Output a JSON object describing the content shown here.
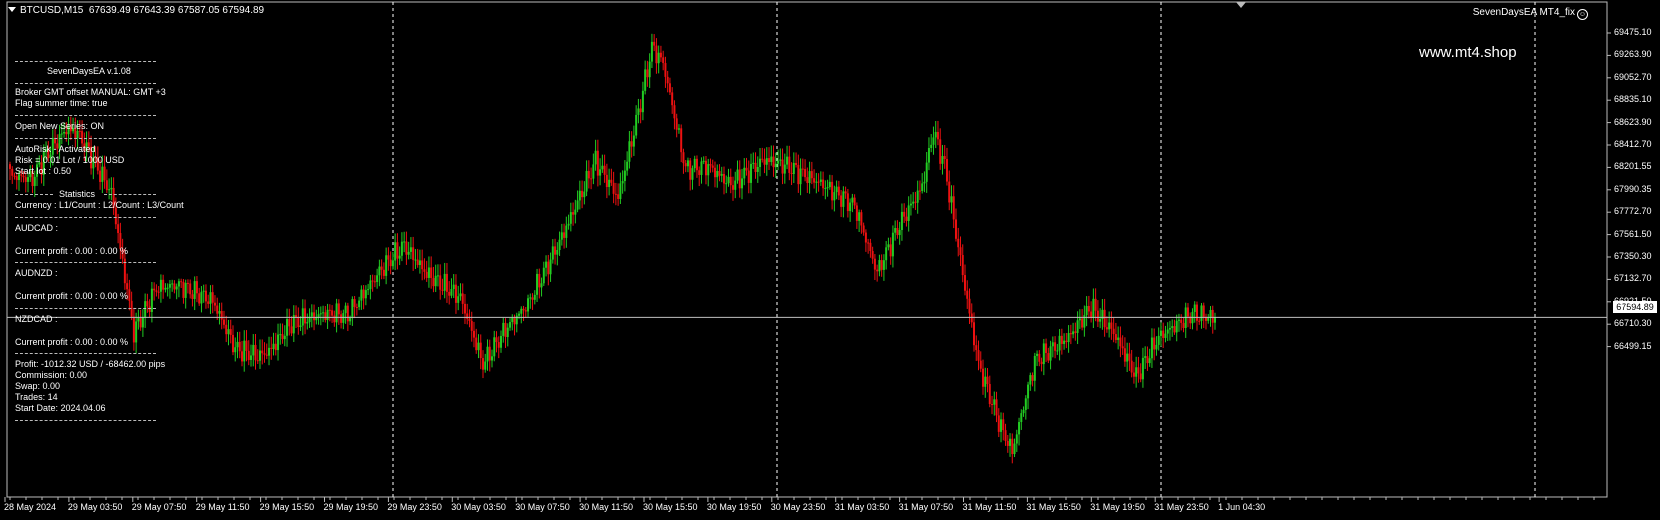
{
  "header": {
    "symbol": "BTCUSD,M15",
    "ohlc": "67639.49 67643.39 67587.05 67594.89",
    "ea_label": "SevenDaysEA MT4_fix",
    "watermark": "www.mt4.shop"
  },
  "panel": {
    "title": "SevenDaysEA  v.1.08",
    "broker": "Broker GMT offset MANUAL:  GMT +3",
    "summer": "Flag summer time: true",
    "open_series": "Open New Series: ON",
    "autorisk": "AutoRisk - Activated",
    "risk": "Risk = 0.01 Lot / 1000 USD",
    "start_lot": "Start lot : 0.50",
    "stats_title": "Statistics",
    "currency_header": "Currency : L1/Count : L2/Count : L3/Count",
    "pair1": "AUDCAD :",
    "pair1_profit": "Current profit : 0.00 : 0.00 %",
    "pair2": "AUDNZD :",
    "pair2_profit": "Current profit : 0.00 : 0.00 %",
    "pair3": "NZDCAD :",
    "pair3_profit": "Current profit : 0.00 : 0.00 %",
    "profit": "Profit: -1012.32 USD / -68462.00 pips",
    "commission": "Commission: 0.00",
    "swap": "Swap: 0.00",
    "trades": "Trades: 14",
    "start_date": "Start Date: 2024.04.06"
  },
  "price_label": "67594.89",
  "y_ticks": [
    "69475.10",
    "69263.90",
    "69052.70",
    "68835.10",
    "68623.90",
    "68412.70",
    "68201.55",
    "67990.35",
    "67772.70",
    "67561.50",
    "67350.30",
    "67132.70",
    "66921.50",
    "66710.30",
    "66499.15"
  ],
  "x_ticks": [
    "28 May 2024",
    "29 May 03:50",
    "29 May 07:50",
    "29 May 11:50",
    "29 May 15:50",
    "29 May 19:50",
    "29 May 23:50",
    "30 May 03:50",
    "30 May 07:50",
    "30 May 11:50",
    "30 May 15:50",
    "30 May 19:50",
    "30 May 23:50",
    "31 May 03:50",
    "31 May 07:50",
    "31 May 11:50",
    "31 May 15:50",
    "31 May 19:50",
    "31 May 23:50",
    "1 Jun 04:30"
  ],
  "colors": {
    "background": "#000000",
    "bull": "#22cc22",
    "bear": "#ee1111",
    "grid": "#ffffff",
    "price_line": "#c0c0c0"
  },
  "chart_data": {
    "type": "candlestick",
    "ylim": [
      66462,
      69584
    ],
    "anchors": [
      [
        0,
        68490
      ],
      [
        10,
        68470
      ],
      [
        15,
        68600
      ],
      [
        25,
        68780
      ],
      [
        30,
        68760
      ],
      [
        38,
        68560
      ],
      [
        45,
        68380
      ],
      [
        55,
        67500
      ],
      [
        65,
        67780
      ],
      [
        75,
        67800
      ],
      [
        90,
        67700
      ],
      [
        100,
        67400
      ],
      [
        110,
        67350
      ],
      [
        115,
        67380
      ],
      [
        125,
        67560
      ],
      [
        140,
        67620
      ],
      [
        150,
        67610
      ],
      [
        165,
        67900
      ],
      [
        175,
        68050
      ],
      [
        185,
        67870
      ],
      [
        200,
        67720
      ],
      [
        210,
        67300
      ],
      [
        220,
        67520
      ],
      [
        230,
        67680
      ],
      [
        245,
        68100
      ],
      [
        260,
        68580
      ],
      [
        270,
        68350
      ],
      [
        280,
        68950
      ],
      [
        285,
        69300
      ],
      [
        290,
        69200
      ],
      [
        300,
        68530
      ],
      [
        310,
        68550
      ],
      [
        320,
        68430
      ],
      [
        335,
        68590
      ],
      [
        345,
        68550
      ],
      [
        360,
        68440
      ],
      [
        375,
        68300
      ],
      [
        385,
        67880
      ],
      [
        395,
        68180
      ],
      [
        405,
        68420
      ],
      [
        410,
        68770
      ],
      [
        415,
        68550
      ],
      [
        425,
        67700
      ],
      [
        430,
        67300
      ],
      [
        440,
        66900
      ],
      [
        445,
        66750
      ],
      [
        455,
        67320
      ],
      [
        470,
        67470
      ],
      [
        480,
        67660
      ],
      [
        490,
        67500
      ],
      [
        500,
        67220
      ],
      [
        510,
        67470
      ],
      [
        525,
        67620
      ],
      [
        535,
        67590
      ]
    ]
  }
}
